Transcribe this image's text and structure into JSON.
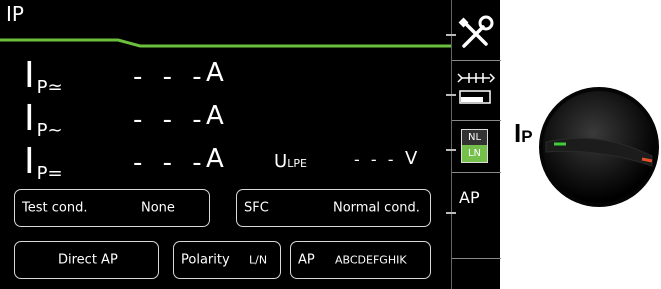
{
  "header": {
    "title": "IP"
  },
  "readings": [
    {
      "symbol": "I",
      "subscript": "P≃",
      "value": "- - -",
      "unit": "A"
    },
    {
      "symbol": "I",
      "subscript": "P~",
      "value": "- - -",
      "unit": "A"
    },
    {
      "symbol": "I",
      "subscript": "P=",
      "value": "- - -",
      "unit": "A"
    }
  ],
  "ulpe": {
    "symbol": "U",
    "subscript": "LPE",
    "value": "- - -",
    "unit": "V"
  },
  "params": {
    "test_cond_label": "Test cond.",
    "test_cond_value": "None",
    "sfc_label": "SFC",
    "sfc_value": "Normal cond.",
    "direct_ap": "Direct AP",
    "polarity_label": "Polarity",
    "polarity_value": "L/N",
    "ap_label": "AP",
    "ap_value": "ABCDEFGHIK"
  },
  "sidebar": {
    "nl": "NL",
    "ln": "LN",
    "ap": "AP"
  },
  "knob": {
    "label": "I",
    "label_sub": "P"
  },
  "colors": {
    "accent": "#6cbf3c",
    "knob_left_mark": "#3ccc3c",
    "knob_right_mark": "#e0502a"
  }
}
